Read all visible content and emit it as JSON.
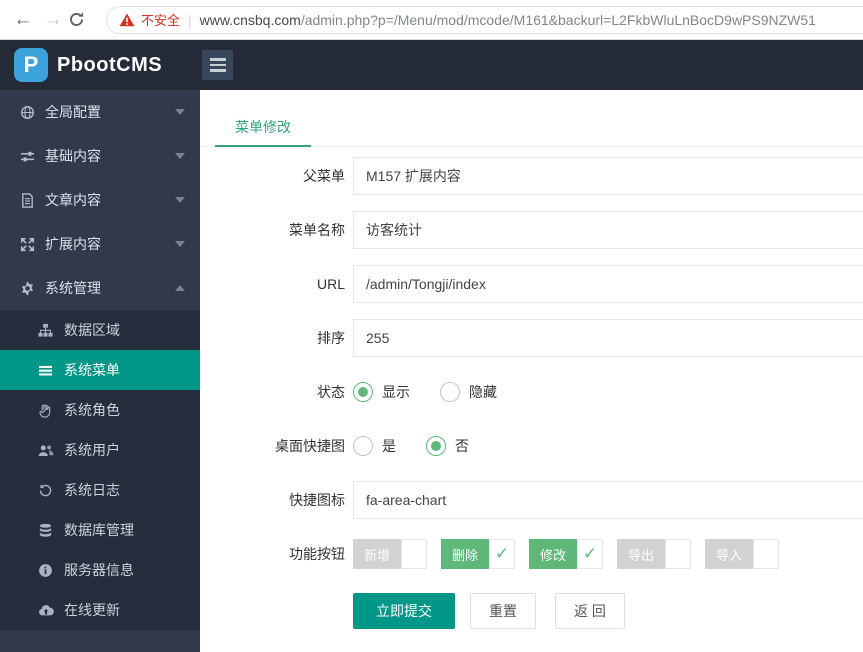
{
  "browser": {
    "back_icon": "←",
    "forward_icon": "→",
    "security_warning": "不安全",
    "separator": "|",
    "url_domain": "www.cnsbq.com",
    "url_path": "/admin.php?p=/Menu/mod/mcode/M161&backurl=L2FkbWluLnBocD9wPS9NZW51"
  },
  "header": {
    "logo_letter": "P",
    "logo_text": "PbootCMS"
  },
  "sidebar": {
    "items": [
      {
        "label": "全局配置",
        "icon": "globe-icon",
        "expanded": false
      },
      {
        "label": "基础内容",
        "icon": "sliders-icon",
        "expanded": false
      },
      {
        "label": "文章内容",
        "icon": "file-icon",
        "expanded": false
      },
      {
        "label": "扩展内容",
        "icon": "arrows-icon",
        "expanded": false
      },
      {
        "label": "系统管理",
        "icon": "gear-icon",
        "expanded": true
      }
    ],
    "submenu": [
      {
        "label": "数据区域",
        "icon": "sitemap-icon",
        "active": false
      },
      {
        "label": "系统菜单",
        "icon": "list-icon",
        "active": true
      },
      {
        "label": "系统角色",
        "icon": "hand-icon",
        "active": false
      },
      {
        "label": "系统用户",
        "icon": "users-icon",
        "active": false
      },
      {
        "label": "系统日志",
        "icon": "history-icon",
        "active": false
      },
      {
        "label": "数据库管理",
        "icon": "database-icon",
        "active": false
      },
      {
        "label": "服务器信息",
        "icon": "info-icon",
        "active": false
      },
      {
        "label": "在线更新",
        "icon": "cloud-upload-icon",
        "active": false
      }
    ]
  },
  "main": {
    "tab": "菜单修改",
    "fields": {
      "parent_label": "父菜单",
      "parent_value": "M157 扩展内容",
      "name_label": "菜单名称",
      "name_value": "访客统计",
      "url_label": "URL",
      "url_value": "/admin/Tongji/index",
      "sort_label": "排序",
      "sort_value": "255",
      "status_label": "状态",
      "status_options": [
        "显示",
        "隐藏"
      ],
      "status_selected": "显示",
      "shortcut_label": "桌面快捷图",
      "shortcut_options": [
        "是",
        "否"
      ],
      "shortcut_selected": "否",
      "icon_label": "快捷图标",
      "icon_value": "fa-area-chart",
      "function_label": "功能按钮",
      "function_buttons": [
        {
          "label": "新增",
          "checked": false
        },
        {
          "label": "删除",
          "checked": true
        },
        {
          "label": "修改",
          "checked": true
        },
        {
          "label": "导出",
          "checked": false
        },
        {
          "label": "导入",
          "checked": false
        }
      ]
    },
    "actions": {
      "submit": "立即提交",
      "reset": "重置",
      "back": "返 回"
    }
  },
  "colors": {
    "accent_teal": "#009688",
    "accent_green": "#5FB878",
    "tab_green": "#34a27b",
    "warning_red": "#d93025",
    "header_bg": "#242a38",
    "sidebar_bg": "#303a4c",
    "submenu_bg": "#262e3d",
    "logo_blue": "#3da1dc"
  }
}
